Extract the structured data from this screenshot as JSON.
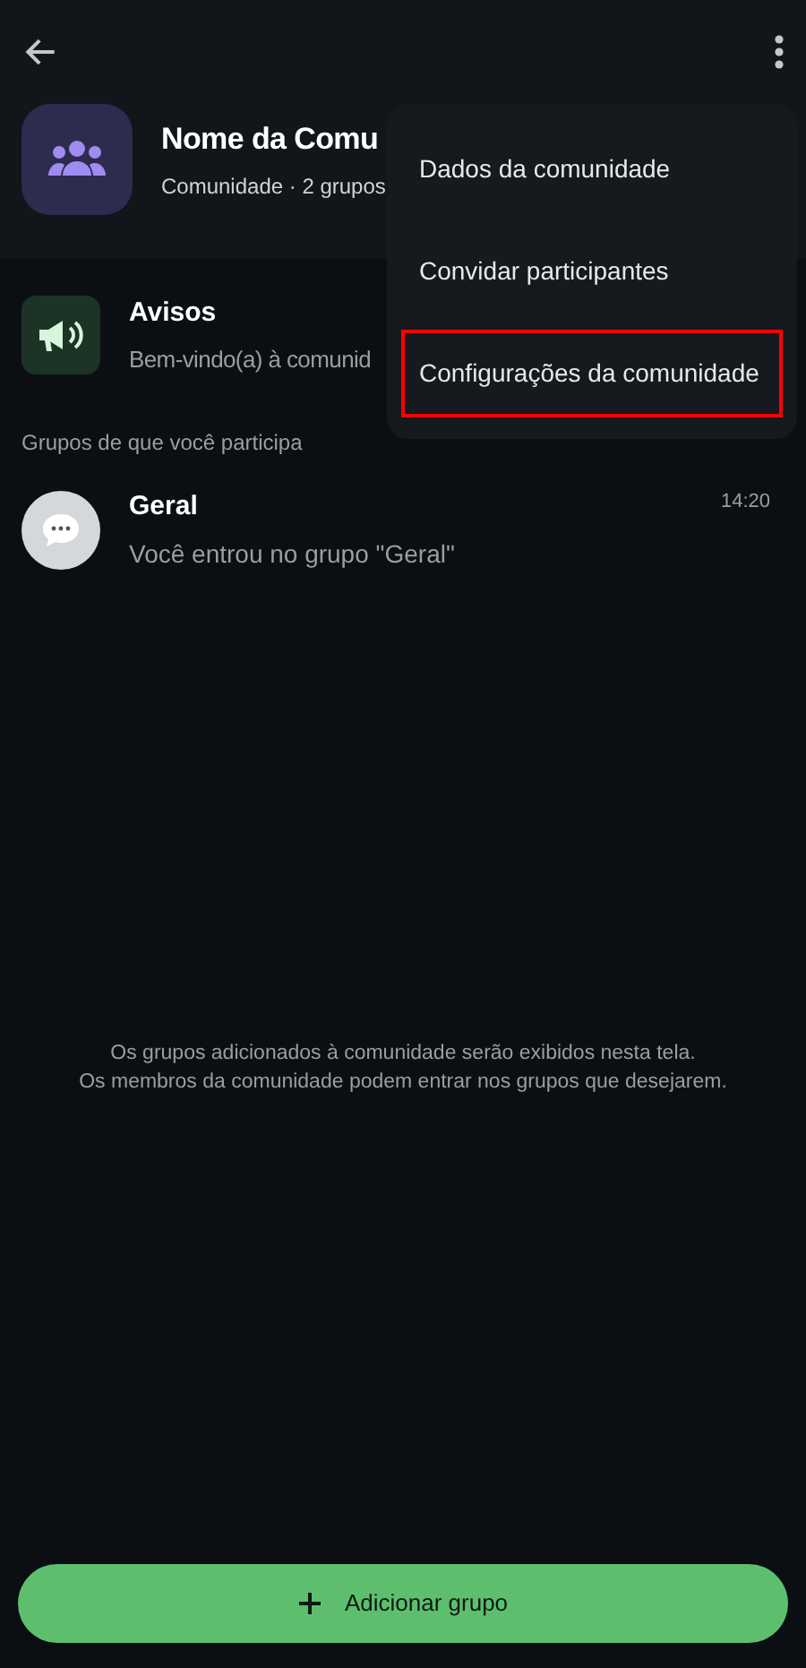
{
  "header": {
    "name": "Nome da Comu",
    "subtitle": "Comunidade · 2 grupos"
  },
  "announcements": {
    "title": "Avisos",
    "preview": "Bem-vindo(a) à comunid"
  },
  "section_title": "Grupos de que você participa",
  "groups": [
    {
      "name": "Geral",
      "time": "14:20",
      "preview": "Você entrou no grupo \"Geral\""
    }
  ],
  "info": [
    "Os grupos adicionados à comunidade serão exibidos nesta tela.",
    "Os membros da comunidade podem entrar nos grupos que desejarem."
  ],
  "add_button": "Adicionar grupo",
  "menu": [
    {
      "label": "Dados da comunidade",
      "highlighted": false
    },
    {
      "label": "Convidar participantes",
      "highlighted": false
    },
    {
      "label": "Configurações da comunidade",
      "highlighted": true
    }
  ]
}
